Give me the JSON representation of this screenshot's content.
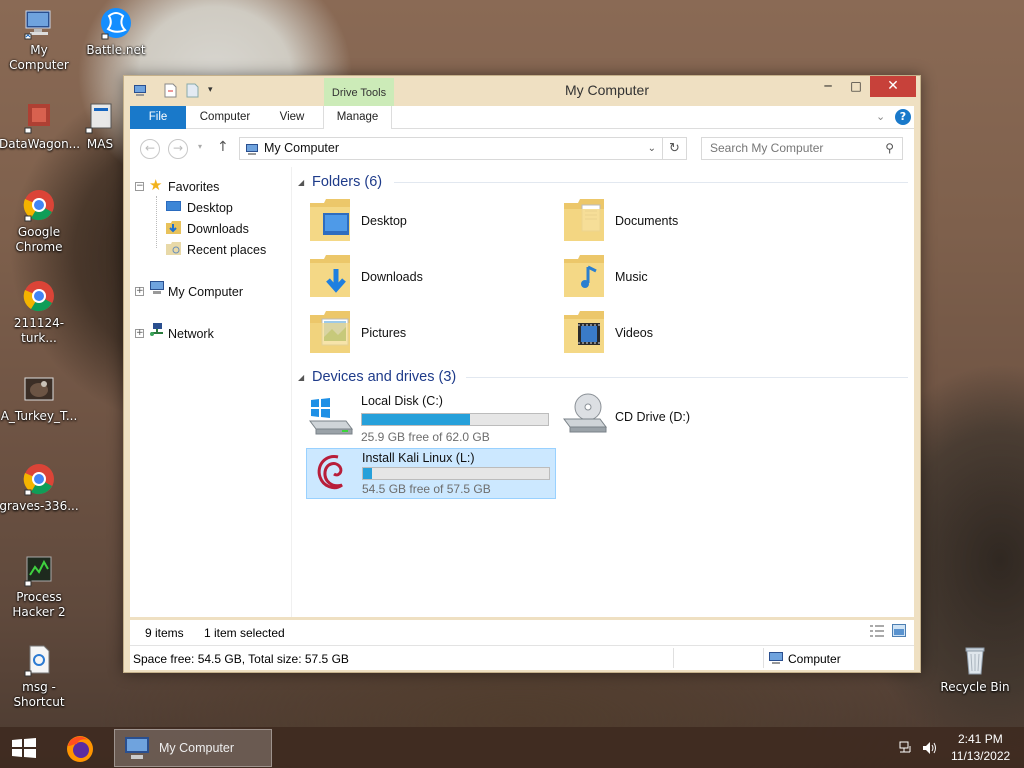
{
  "desktop": {
    "icons": [
      {
        "label": "My Computer",
        "icon": "computer-icon"
      },
      {
        "label": "Battle.net",
        "icon": "battlenet-icon"
      },
      {
        "label": "DataWagon...",
        "icon": "datawagon-icon"
      },
      {
        "label": "MAS",
        "icon": "mas-icon"
      },
      {
        "label": "Google Chrome",
        "icon": "chrome-icon"
      },
      {
        "label": "211124-turk...",
        "icon": "chrome-icon"
      },
      {
        "label": "A_Turkey_T...",
        "icon": "image-icon"
      },
      {
        "label": "graves-336...",
        "icon": "chrome-icon"
      },
      {
        "label": "Process Hacker 2",
        "icon": "process-hacker-icon"
      },
      {
        "label": "msg - Shortcut",
        "icon": "shortcut-icon"
      },
      {
        "label": "Recycle Bin",
        "icon": "recycle-bin-icon"
      }
    ]
  },
  "window": {
    "title": "My Computer",
    "context_tab": "Drive Tools",
    "ribbon_tabs": [
      "File",
      "Computer",
      "View",
      "Manage"
    ],
    "address": "My Computer",
    "search_placeholder": "Search My Computer",
    "nav": {
      "favorites_label": "Favorites",
      "favorites": [
        "Desktop",
        "Downloads",
        "Recent places"
      ],
      "my_computer": "My Computer",
      "network": "Network"
    },
    "groups": {
      "folders_title": "Folders (6)",
      "drives_title": "Devices and drives (3)"
    },
    "folders": [
      "Desktop",
      "Documents",
      "Downloads",
      "Music",
      "Pictures",
      "Videos"
    ],
    "drives": [
      {
        "name": "Local Disk (C:)",
        "free_text": "25.9 GB free of 62.0 GB",
        "used_fraction": 0.58,
        "icon": "windows-drive-icon"
      },
      {
        "name": "CD Drive (D:)",
        "icon": "cd-drive-icon"
      },
      {
        "name": "Install Kali Linux (L:)",
        "free_text": "54.5 GB free of 57.5 GB",
        "used_fraction": 0.05,
        "selected": true,
        "icon": "debian-drive-icon"
      }
    ],
    "status": {
      "items": "9 items",
      "selected": "1 item selected"
    },
    "info": {
      "space": "Space free: 54.5 GB, Total size: 57.5 GB",
      "location": "Computer"
    }
  },
  "taskbar": {
    "explorer_label": "My Computer",
    "time": "2:41 PM",
    "date": "11/13/2022"
  },
  "colors": {
    "accent": "#1979ca",
    "progress": "#26a0da",
    "close_button": "#c7413a",
    "drive_tools_tab": "#ccebb8",
    "selection": "#cce8ff"
  }
}
